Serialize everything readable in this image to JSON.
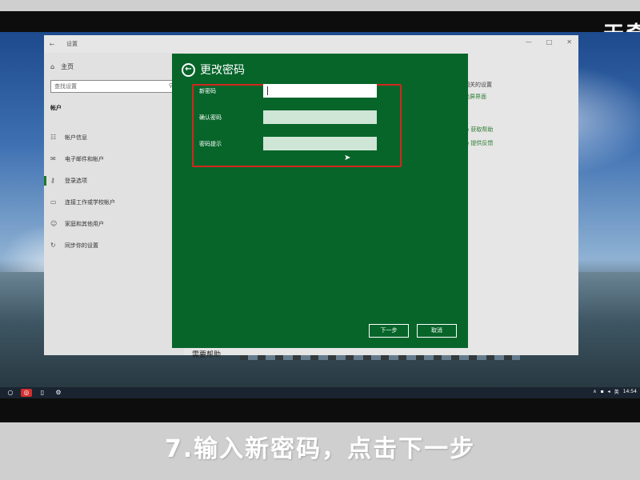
{
  "watermark": "天奇",
  "settings": {
    "title": "设置",
    "home": "主页",
    "search_placeholder": "查找设置",
    "section": "帐户",
    "nav": [
      {
        "label": "帐户信息",
        "icon": "person-card-icon"
      },
      {
        "label": "电子邮件和帐户",
        "icon": "mail-icon"
      },
      {
        "label": "登录选项",
        "icon": "key-icon",
        "active": true
      },
      {
        "label": "连接工作或学校帐户",
        "icon": "briefcase-icon"
      },
      {
        "label": "家庭和其他用户",
        "icon": "people-icon"
      },
      {
        "label": "同步你的设置",
        "icon": "sync-icon"
      }
    ],
    "right_links": [
      "相关的设置",
      "锁屏界面"
    ],
    "help": [
      "获取帮助",
      "提供反馈"
    ]
  },
  "dialog": {
    "title": "更改密码",
    "fields": [
      {
        "label": "新密码",
        "value": ""
      },
      {
        "label": "确认密码",
        "value": ""
      },
      {
        "label": "密码提示",
        "value": ""
      }
    ],
    "next_label": "下一步",
    "cancel_label": "取消"
  },
  "behind_text": "需要帮助",
  "taskbar": {
    "time": "14:54",
    "ime": "英"
  },
  "caption": "7.输入新密码，点击下一步"
}
